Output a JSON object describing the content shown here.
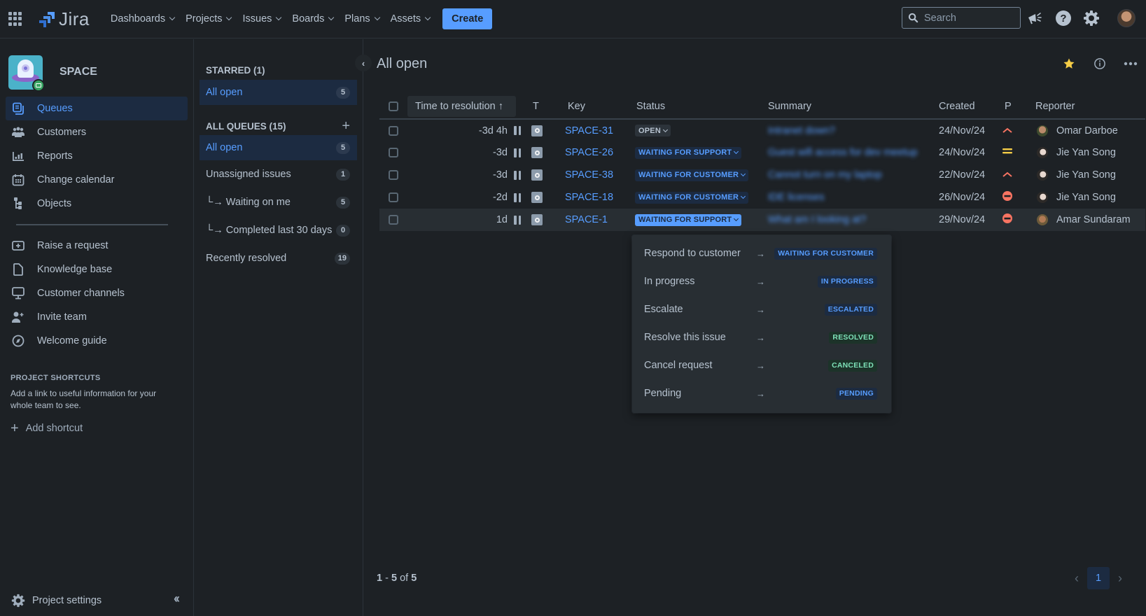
{
  "topbar": {
    "logo_text": "Jira",
    "nav": [
      {
        "label": "Dashboards"
      },
      {
        "label": "Projects"
      },
      {
        "label": "Issues"
      },
      {
        "label": "Boards"
      },
      {
        "label": "Plans"
      },
      {
        "label": "Assets"
      }
    ],
    "create_label": "Create",
    "search_placeholder": "Search"
  },
  "sidebar": {
    "project_name": "SPACE",
    "items": [
      {
        "label": "Queues",
        "icon": "queues-icon",
        "active": true
      },
      {
        "label": "Customers",
        "icon": "customers-icon"
      },
      {
        "label": "Reports",
        "icon": "reports-icon"
      },
      {
        "label": "Change calendar",
        "icon": "calendar-icon"
      },
      {
        "label": "Objects",
        "icon": "objects-icon"
      }
    ],
    "secondary_items": [
      {
        "label": "Raise a request",
        "icon": "raise-request-icon"
      },
      {
        "label": "Knowledge base",
        "icon": "document-icon"
      },
      {
        "label": "Customer channels",
        "icon": "monitor-icon"
      },
      {
        "label": "Invite team",
        "icon": "invite-user-icon"
      },
      {
        "label": "Welcome guide",
        "icon": "compass-icon"
      }
    ],
    "shortcuts_title": "PROJECT SHORTCUTS",
    "shortcuts_desc": "Add a link to useful information for your whole team to see.",
    "add_shortcut": "Add shortcut",
    "project_settings": "Project settings"
  },
  "queues": {
    "starred_title": "STARRED (1)",
    "starred": [
      {
        "label": "All open",
        "count": "5"
      }
    ],
    "all_title": "ALL QUEUES (15)",
    "all": [
      {
        "label": "All open",
        "count": "5"
      },
      {
        "label": "Unassigned issues",
        "count": "1"
      },
      {
        "label": "└→ Waiting on me",
        "count": "5"
      },
      {
        "label": "└→ Completed last 30 days",
        "count": "0"
      },
      {
        "label": "Recently resolved",
        "count": "19"
      }
    ]
  },
  "main": {
    "title": "All open",
    "columns": {
      "ttr": "Time to resolution ↑",
      "type": "T",
      "key": "Key",
      "status": "Status",
      "summary": "Summary",
      "created": "Created",
      "priority": "P",
      "reporter": "Reporter"
    },
    "rows": [
      {
        "ttr": "-3d 4h",
        "key": "SPACE-31",
        "status": "OPEN",
        "status_style": "open",
        "summary": "Intranet down?",
        "created": "24/Nov/24",
        "priority": "high",
        "reporter": "Omar Darboe"
      },
      {
        "ttr": "-3d",
        "key": "SPACE-26",
        "status": "WAITING FOR SUPPORT",
        "status_style": "blue",
        "summary": "Guest wifi access for dev meetup",
        "created": "24/Nov/24",
        "priority": "medium",
        "reporter": "Jie Yan Song"
      },
      {
        "ttr": "-3d",
        "key": "SPACE-38",
        "status": "WAITING FOR CUSTOMER",
        "status_style": "blue",
        "summary": "Cannot turn on my laptop",
        "created": "22/Nov/24",
        "priority": "high",
        "reporter": "Jie Yan Song"
      },
      {
        "ttr": "-2d",
        "key": "SPACE-18",
        "status": "WAITING FOR CUSTOMER",
        "status_style": "blue",
        "summary": "IDE licenses",
        "created": "26/Nov/24",
        "priority": "blocker",
        "reporter": "Jie Yan Song"
      },
      {
        "ttr": "1d",
        "key": "SPACE-1",
        "status": "WAITING FOR SUPPORT",
        "status_style": "blue-selected",
        "summary": "What am I looking at?",
        "created": "29/Nov/24",
        "priority": "blocker",
        "reporter": "Amar Sundaram"
      }
    ],
    "transitions": [
      {
        "label": "Respond to customer",
        "target": "WAITING FOR CUSTOMER",
        "style": "blue"
      },
      {
        "label": "In progress",
        "target": "IN PROGRESS",
        "style": "blue"
      },
      {
        "label": "Escalate",
        "target": "ESCALATED",
        "style": "blue"
      },
      {
        "label": "Resolve this issue",
        "target": "RESOLVED",
        "style": "green"
      },
      {
        "label": "Cancel request",
        "target": "CANCELED",
        "style": "green"
      },
      {
        "label": "Pending",
        "target": "PENDING",
        "style": "blue"
      }
    ],
    "pagination": {
      "start": "1",
      "end": "5",
      "total": "5",
      "of_label": "of",
      "current_page": "1"
    }
  },
  "colors": {
    "accent": "#579dff",
    "background": "#1d2125",
    "priority_high": "#f87462",
    "priority_medium": "#f5cd47",
    "star": "#f5cd47"
  }
}
